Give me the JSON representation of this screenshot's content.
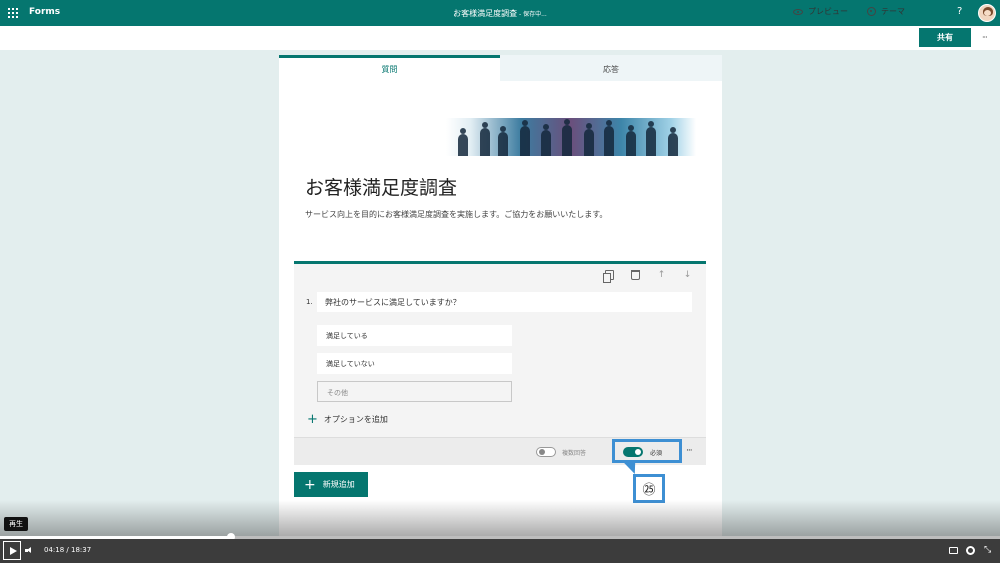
{
  "topbar": {
    "app_name": "Forms",
    "form_title": "お客様満足度調査",
    "save_status": " - 保存中...",
    "help": "?"
  },
  "commands": {
    "preview": "プレビュー",
    "theme": "テーマ",
    "share": "共有",
    "more": "···"
  },
  "tabs": {
    "questions": "質問",
    "responses": "応答"
  },
  "form": {
    "title": "お客様満足度調査",
    "description": "サービス向上を目的にお客様満足度調査を実施します。ご協力をお願いいたします。"
  },
  "question": {
    "number": "1.",
    "text": "弊社のサービスに満足していますか？",
    "options": [
      "満足している",
      "満足していない"
    ],
    "other_placeholder": "その他",
    "add_option": "オプションを追加",
    "multiple_answers_label": "複数回答",
    "multiple_answers_on": false,
    "required_label": "必須",
    "required_on": true,
    "more": "···"
  },
  "callout": {
    "step": "㉕"
  },
  "new_button": {
    "label": "新規追加"
  },
  "player": {
    "tooltip": "再生",
    "current_time": "04:18",
    "separator": "/",
    "total_time": "18:37",
    "progress_percent": 23.1
  },
  "colors": {
    "brand": "#05766f",
    "highlight": "#3d8fd3"
  }
}
